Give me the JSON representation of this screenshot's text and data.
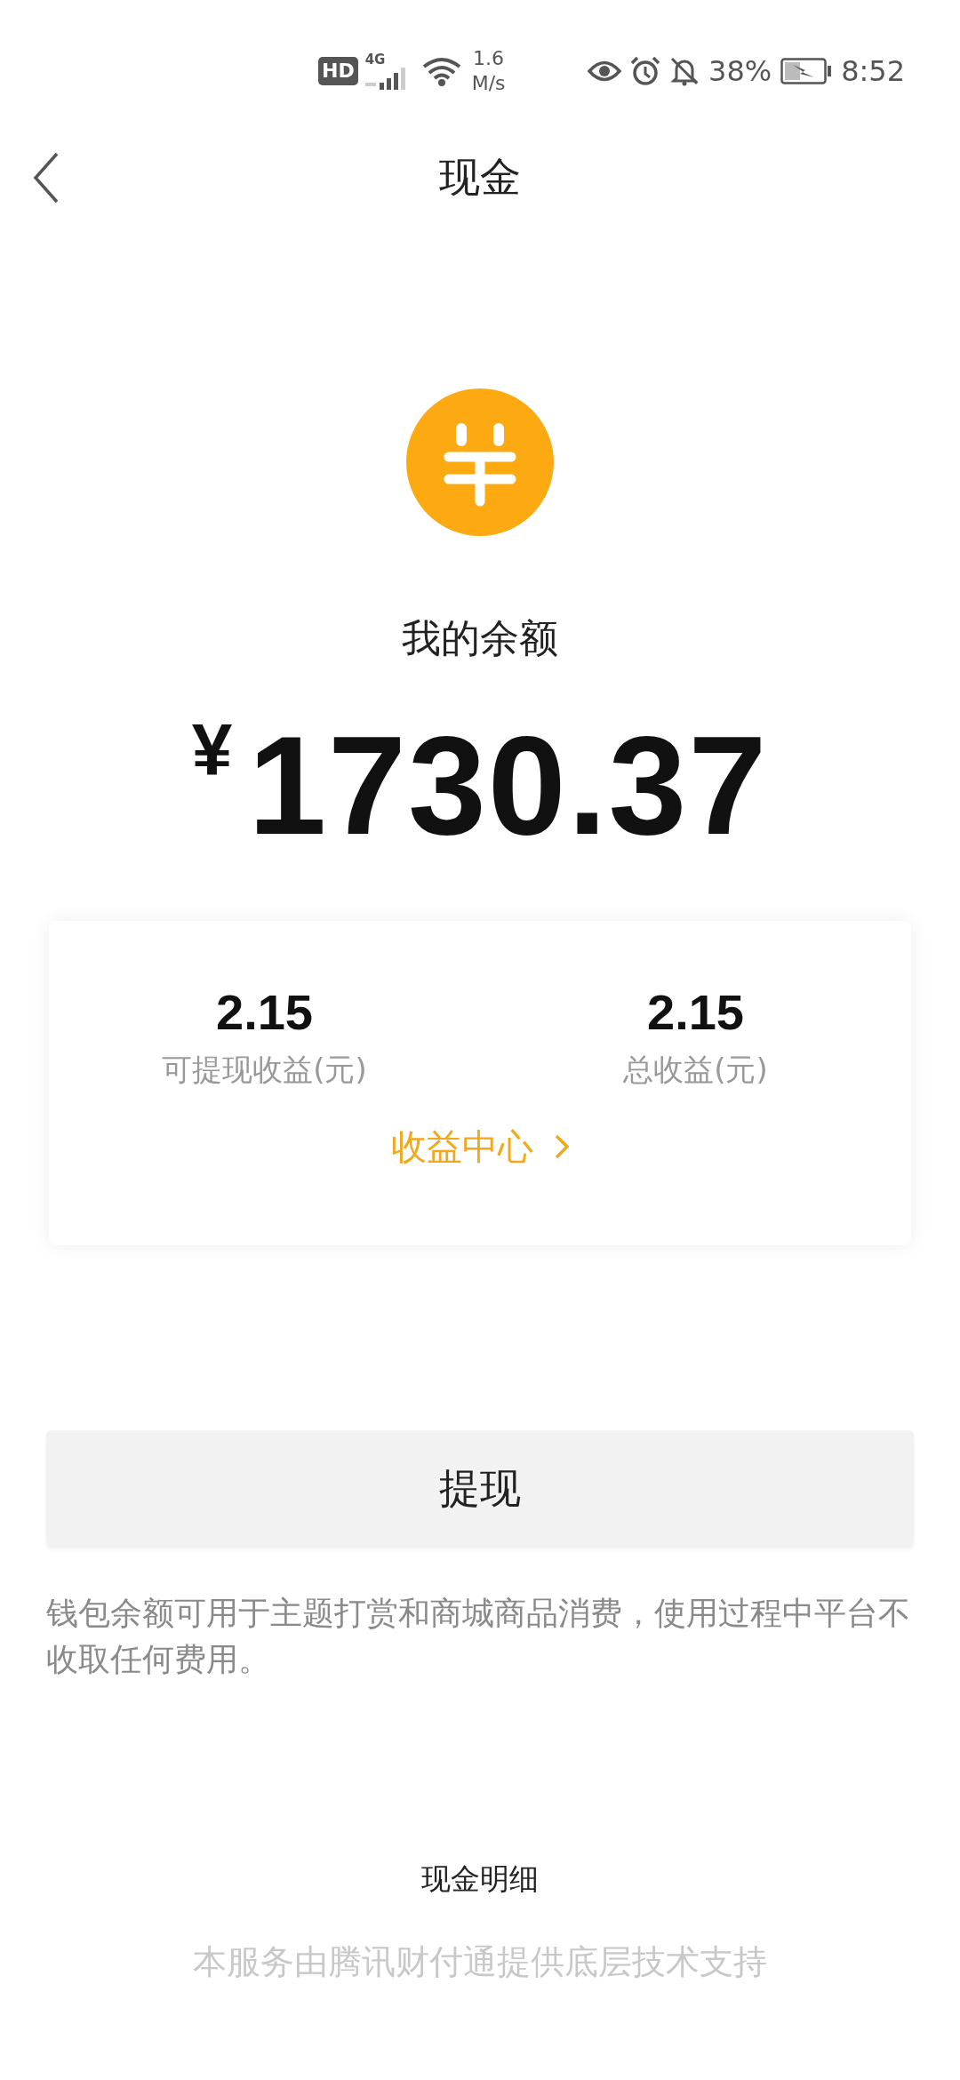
{
  "status_bar": {
    "hd": "HD",
    "network": "4G",
    "speed": "1.6",
    "speed_unit": "M/s",
    "battery": "38%",
    "time": "8:52"
  },
  "nav": {
    "title": "现金"
  },
  "balance": {
    "label": "我的余额",
    "currency": "¥",
    "amount": "1730.37"
  },
  "earnings": {
    "stats": [
      {
        "value": "2.15",
        "label": "可提现收益(元)"
      },
      {
        "value": "2.15",
        "label": "总收益(元)"
      }
    ],
    "link": "收益中心"
  },
  "withdraw_button": "提现",
  "note": "钱包余额可用于主题打赏和商城商品消费，使用过程中平台不收取任何费用。",
  "details_link": "现金明细",
  "footer": "本服务由腾讯财付通提供底层技术支持"
}
